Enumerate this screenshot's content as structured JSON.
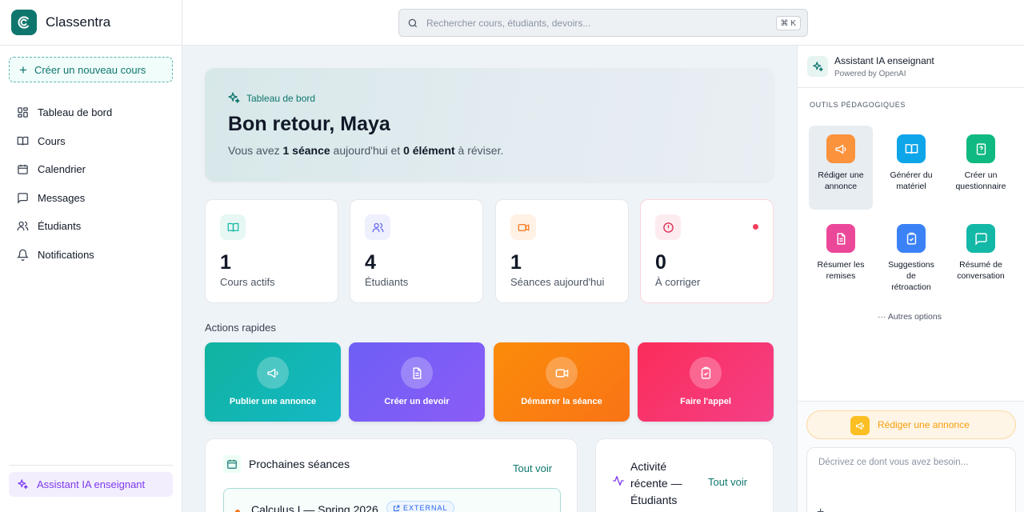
{
  "app": {
    "name": "Classentra"
  },
  "sidebar": {
    "new_course_label": "Créer un nouveau cours",
    "items": [
      {
        "label": "Tableau de bord",
        "icon": "dashboard-icon"
      },
      {
        "label": "Cours",
        "icon": "book-icon"
      },
      {
        "label": "Calendrier",
        "icon": "calendar-icon"
      },
      {
        "label": "Messages",
        "icon": "message-icon"
      },
      {
        "label": "Étudiants",
        "icon": "users-icon"
      },
      {
        "label": "Notifications",
        "icon": "bell-icon"
      }
    ],
    "ai_label": "Assistant IA enseignant"
  },
  "search": {
    "placeholder": "Rechercher cours, étudiants, devoirs...",
    "shortcut": "⌘ K"
  },
  "hero": {
    "tag": "Tableau de bord",
    "title": "Bon retour, Maya",
    "sub_prefix": "Vous avez ",
    "sessions_bold": "1 séance",
    "sub_middle": " aujourd'hui et ",
    "items_bold": "0 élément",
    "sub_suffix": " à réviser."
  },
  "stats": [
    {
      "value": "1",
      "label": "Cours actifs",
      "icon": "book-open-icon",
      "color": "#14b8a6",
      "bg": "#e6f7f4"
    },
    {
      "value": "4",
      "label": "Étudiants",
      "icon": "users-icon",
      "color": "#6366f1",
      "bg": "#eef0fd"
    },
    {
      "value": "1",
      "label": "Séances aujourd'hui",
      "icon": "video-icon",
      "color": "#f97316",
      "bg": "#fff1e4"
    },
    {
      "value": "0",
      "label": "À corriger",
      "icon": "alert-circle-icon",
      "color": "#e11d48",
      "bg": "#fdecef"
    }
  ],
  "quick_actions": {
    "title": "Actions rapides",
    "items": [
      {
        "label": "Publier une annonce",
        "icon": "megaphone-icon",
        "from": "#11b3a0",
        "to": "#14b8c5"
      },
      {
        "label": "Créer un devoir",
        "icon": "document-icon",
        "from": "#6d5ff5",
        "to": "#8b5cf6"
      },
      {
        "label": "Démarrer la séance",
        "icon": "video-icon",
        "from": "#fb8c0a",
        "to": "#f97316"
      },
      {
        "label": "Faire l'appel",
        "icon": "clipboard-check-icon",
        "from": "#fb2d5a",
        "to": "#f43f87"
      }
    ]
  },
  "upcoming": {
    "title": "Prochaines séances",
    "see_all": "Tout voir",
    "session_title": "Calculus I — Spring 2026",
    "badge": "EXTERNAL"
  },
  "activity": {
    "title_line1": "Activité",
    "title_line2": "récente —",
    "title_line3": "Étudiants",
    "see_all": "Tout voir"
  },
  "assistant": {
    "title": "Assistant IA enseignant",
    "subtitle": "Powered by OpenAI",
    "tools_label": "OUTILS PÉDAGOGIQUES",
    "tools": [
      {
        "line1": "Rédiger une",
        "line2": "annonce",
        "line3": "",
        "icon": "megaphone-icon",
        "color": "#fb923c"
      },
      {
        "line1": "Générer du",
        "line2": "matériel",
        "line3": "",
        "icon": "book-open-icon",
        "color": "#0ea5e9"
      },
      {
        "line1": "Créer un",
        "line2": "questionnaire",
        "line3": "",
        "icon": "question-icon",
        "color": "#10b981"
      },
      {
        "line1": "Résumer les",
        "line2": "remises",
        "line3": "",
        "icon": "document-icon",
        "color": "#ec4899"
      },
      {
        "line1": "Suggestions",
        "line2": "de",
        "line3": "rétroaction",
        "icon": "clipboard-check-icon",
        "color": "#3b82f6"
      },
      {
        "line1": "Résumé de",
        "line2": "conversation",
        "line3": "",
        "icon": "message-icon",
        "color": "#14b8a6"
      }
    ],
    "more_label": "Autres options",
    "active_button": "Rédiger une annonce",
    "input_placeholder": "Décrivez ce dont vous avez besoin..."
  },
  "colors": {
    "accent": "#0f766e",
    "ai_purple": "#7c3aed"
  }
}
